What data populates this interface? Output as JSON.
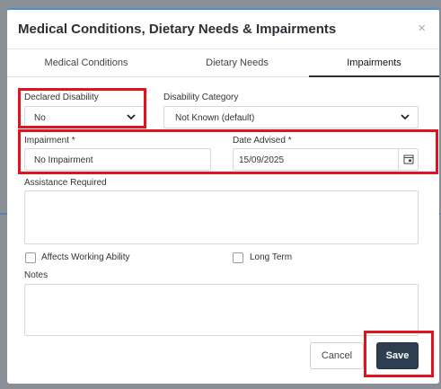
{
  "dialog": {
    "title": "Medical Conditions, Dietary Needs & Impairments",
    "close_glyph": "×"
  },
  "tabs": [
    {
      "label": "Medical Conditions",
      "active": false
    },
    {
      "label": "Dietary Needs",
      "active": false
    },
    {
      "label": "Impairments",
      "active": true
    }
  ],
  "form": {
    "declared_disability": {
      "label": "Declared Disability",
      "value": "No"
    },
    "disability_category": {
      "label": "Disability Category",
      "value": "Not Known (default)"
    },
    "impairment": {
      "label": "Impairment *",
      "value": "No Impairment"
    },
    "date_advised": {
      "label": "Date Advised *",
      "value": "15/09/2025"
    },
    "assistance_required": {
      "label": "Assistance Required",
      "value": ""
    },
    "affects_working_ability": {
      "label": "Affects Working Ability",
      "checked": false
    },
    "long_term": {
      "label": "Long Term",
      "checked": false
    },
    "notes": {
      "label": "Notes",
      "value": ""
    }
  },
  "buttons": {
    "cancel": "Cancel",
    "save": "Save"
  },
  "colors": {
    "accent_top": "#4a90d9",
    "save_bg": "#2d3e50",
    "highlight": "#e0141e"
  }
}
